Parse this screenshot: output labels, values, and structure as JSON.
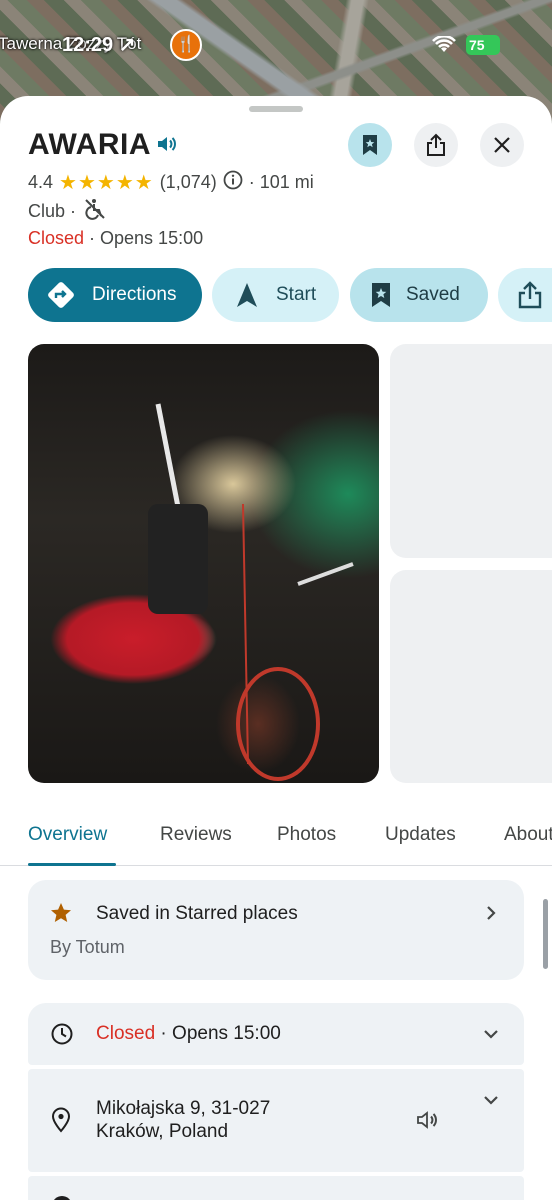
{
  "map": {
    "label": "Tawerna Zozzy Tót",
    "time": "12:29 ↗",
    "battery": "75"
  },
  "place": {
    "name": "AWARIA",
    "rating": "4.4",
    "stars": "★★★★★",
    "review_count": "(1,074)",
    "distance": "· 101 mi",
    "category": "Club ·",
    "status": "Closed",
    "opens": " · Opens 15:00"
  },
  "actions": {
    "directions": "Directions",
    "start": "Start",
    "saved": "Saved"
  },
  "tabs": [
    "Overview",
    "Reviews",
    "Photos",
    "Updates",
    "About"
  ],
  "saved_card": {
    "title": "Saved in Starred places",
    "subtitle": "By Totum"
  },
  "hours_card": {
    "status": "Closed",
    "opens": " · Opens 15:00"
  },
  "address_card": {
    "line1": "Mikołajska 9, 31-027",
    "line2": "Kraków, Poland"
  },
  "colors": {
    "accent": "#0e7490",
    "closed": "#d93025",
    "star": "#f4b400"
  }
}
